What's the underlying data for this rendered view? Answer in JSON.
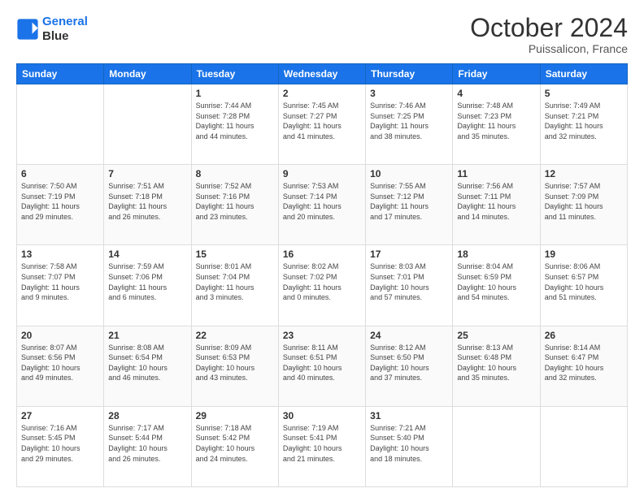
{
  "header": {
    "logo_line1": "General",
    "logo_line2": "Blue",
    "month_title": "October 2024",
    "location": "Puissalicon, France"
  },
  "weekdays": [
    "Sunday",
    "Monday",
    "Tuesday",
    "Wednesday",
    "Thursday",
    "Friday",
    "Saturday"
  ],
  "weeks": [
    [
      {
        "day": "",
        "info": ""
      },
      {
        "day": "",
        "info": ""
      },
      {
        "day": "1",
        "info": "Sunrise: 7:44 AM\nSunset: 7:28 PM\nDaylight: 11 hours\nand 44 minutes."
      },
      {
        "day": "2",
        "info": "Sunrise: 7:45 AM\nSunset: 7:27 PM\nDaylight: 11 hours\nand 41 minutes."
      },
      {
        "day": "3",
        "info": "Sunrise: 7:46 AM\nSunset: 7:25 PM\nDaylight: 11 hours\nand 38 minutes."
      },
      {
        "day": "4",
        "info": "Sunrise: 7:48 AM\nSunset: 7:23 PM\nDaylight: 11 hours\nand 35 minutes."
      },
      {
        "day": "5",
        "info": "Sunrise: 7:49 AM\nSunset: 7:21 PM\nDaylight: 11 hours\nand 32 minutes."
      }
    ],
    [
      {
        "day": "6",
        "info": "Sunrise: 7:50 AM\nSunset: 7:19 PM\nDaylight: 11 hours\nand 29 minutes."
      },
      {
        "day": "7",
        "info": "Sunrise: 7:51 AM\nSunset: 7:18 PM\nDaylight: 11 hours\nand 26 minutes."
      },
      {
        "day": "8",
        "info": "Sunrise: 7:52 AM\nSunset: 7:16 PM\nDaylight: 11 hours\nand 23 minutes."
      },
      {
        "day": "9",
        "info": "Sunrise: 7:53 AM\nSunset: 7:14 PM\nDaylight: 11 hours\nand 20 minutes."
      },
      {
        "day": "10",
        "info": "Sunrise: 7:55 AM\nSunset: 7:12 PM\nDaylight: 11 hours\nand 17 minutes."
      },
      {
        "day": "11",
        "info": "Sunrise: 7:56 AM\nSunset: 7:11 PM\nDaylight: 11 hours\nand 14 minutes."
      },
      {
        "day": "12",
        "info": "Sunrise: 7:57 AM\nSunset: 7:09 PM\nDaylight: 11 hours\nand 11 minutes."
      }
    ],
    [
      {
        "day": "13",
        "info": "Sunrise: 7:58 AM\nSunset: 7:07 PM\nDaylight: 11 hours\nand 9 minutes."
      },
      {
        "day": "14",
        "info": "Sunrise: 7:59 AM\nSunset: 7:06 PM\nDaylight: 11 hours\nand 6 minutes."
      },
      {
        "day": "15",
        "info": "Sunrise: 8:01 AM\nSunset: 7:04 PM\nDaylight: 11 hours\nand 3 minutes."
      },
      {
        "day": "16",
        "info": "Sunrise: 8:02 AM\nSunset: 7:02 PM\nDaylight: 11 hours\nand 0 minutes."
      },
      {
        "day": "17",
        "info": "Sunrise: 8:03 AM\nSunset: 7:01 PM\nDaylight: 10 hours\nand 57 minutes."
      },
      {
        "day": "18",
        "info": "Sunrise: 8:04 AM\nSunset: 6:59 PM\nDaylight: 10 hours\nand 54 minutes."
      },
      {
        "day": "19",
        "info": "Sunrise: 8:06 AM\nSunset: 6:57 PM\nDaylight: 10 hours\nand 51 minutes."
      }
    ],
    [
      {
        "day": "20",
        "info": "Sunrise: 8:07 AM\nSunset: 6:56 PM\nDaylight: 10 hours\nand 49 minutes."
      },
      {
        "day": "21",
        "info": "Sunrise: 8:08 AM\nSunset: 6:54 PM\nDaylight: 10 hours\nand 46 minutes."
      },
      {
        "day": "22",
        "info": "Sunrise: 8:09 AM\nSunset: 6:53 PM\nDaylight: 10 hours\nand 43 minutes."
      },
      {
        "day": "23",
        "info": "Sunrise: 8:11 AM\nSunset: 6:51 PM\nDaylight: 10 hours\nand 40 minutes."
      },
      {
        "day": "24",
        "info": "Sunrise: 8:12 AM\nSunset: 6:50 PM\nDaylight: 10 hours\nand 37 minutes."
      },
      {
        "day": "25",
        "info": "Sunrise: 8:13 AM\nSunset: 6:48 PM\nDaylight: 10 hours\nand 35 minutes."
      },
      {
        "day": "26",
        "info": "Sunrise: 8:14 AM\nSunset: 6:47 PM\nDaylight: 10 hours\nand 32 minutes."
      }
    ],
    [
      {
        "day": "27",
        "info": "Sunrise: 7:16 AM\nSunset: 5:45 PM\nDaylight: 10 hours\nand 29 minutes."
      },
      {
        "day": "28",
        "info": "Sunrise: 7:17 AM\nSunset: 5:44 PM\nDaylight: 10 hours\nand 26 minutes."
      },
      {
        "day": "29",
        "info": "Sunrise: 7:18 AM\nSunset: 5:42 PM\nDaylight: 10 hours\nand 24 minutes."
      },
      {
        "day": "30",
        "info": "Sunrise: 7:19 AM\nSunset: 5:41 PM\nDaylight: 10 hours\nand 21 minutes."
      },
      {
        "day": "31",
        "info": "Sunrise: 7:21 AM\nSunset: 5:40 PM\nDaylight: 10 hours\nand 18 minutes."
      },
      {
        "day": "",
        "info": ""
      },
      {
        "day": "",
        "info": ""
      }
    ]
  ]
}
